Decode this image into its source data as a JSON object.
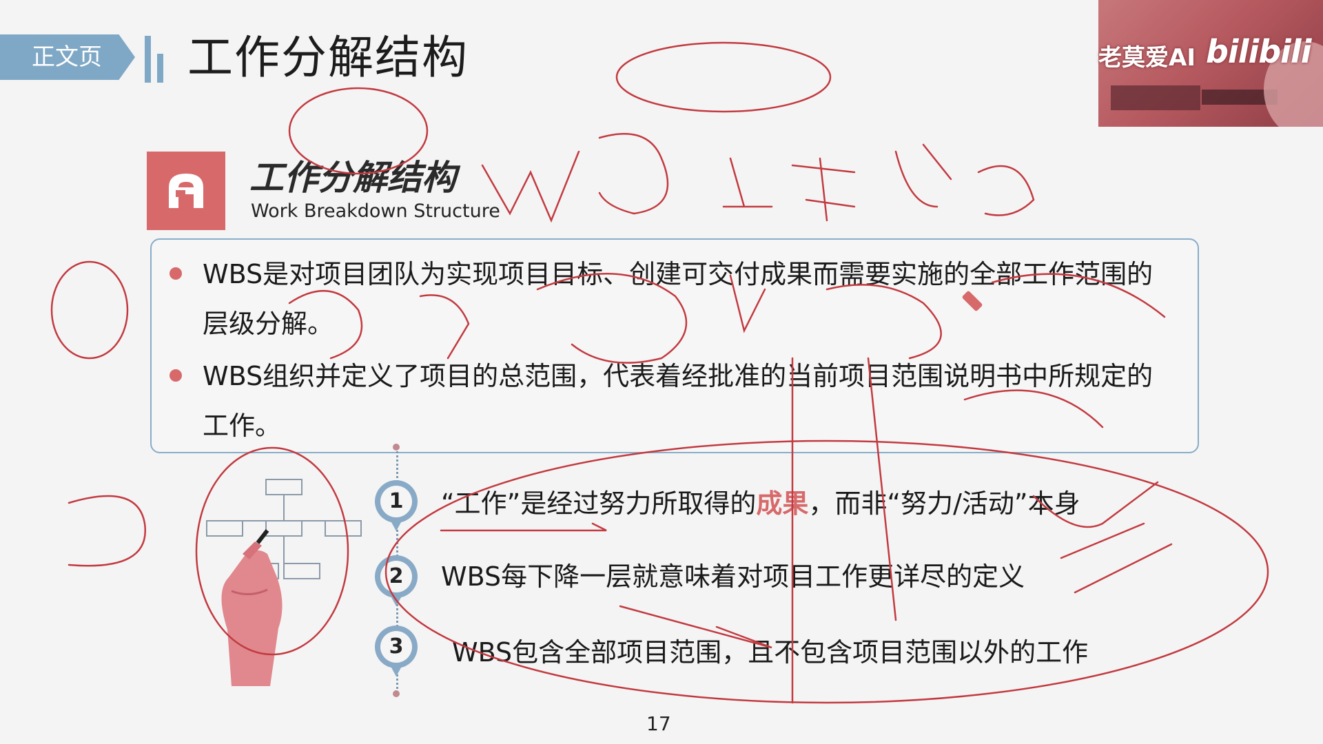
{
  "header": {
    "section_tag": "正文页",
    "page_title": "工作分解结构"
  },
  "overlay": {
    "channel_name": "老莫爱AI",
    "platform_logo": "bilibili"
  },
  "block": {
    "title": "工作分解结构",
    "subtitle": "Work Breakdown Structure",
    "logo_icon": "stylized-a-icon",
    "accent_color": "#d7696a"
  },
  "definitions": [
    "WBS是对项目团队为实现项目目标、创建可交付成果而需要实施的全部工作范围的层级分解。",
    "WBS组织并定义了项目的总范围，代表着经批准的当前项目范围说明书中所规定的工作。"
  ],
  "steps": [
    {
      "number": "1",
      "text_before": "“工作”是经过努力所取得的",
      "highlight": "成果",
      "text_after": "，而非“努力/活动”本身"
    },
    {
      "number": "2",
      "text_before": "WBS每下降一层就意味着对项目工作更详尽的定义",
      "highlight": "",
      "text_after": ""
    },
    {
      "number": "3",
      "text_before": "WBS包含全部项目范围，且不包含项目范围以外的工作",
      "highlight": "",
      "text_after": ""
    }
  ],
  "footer": {
    "page_number": "17"
  }
}
